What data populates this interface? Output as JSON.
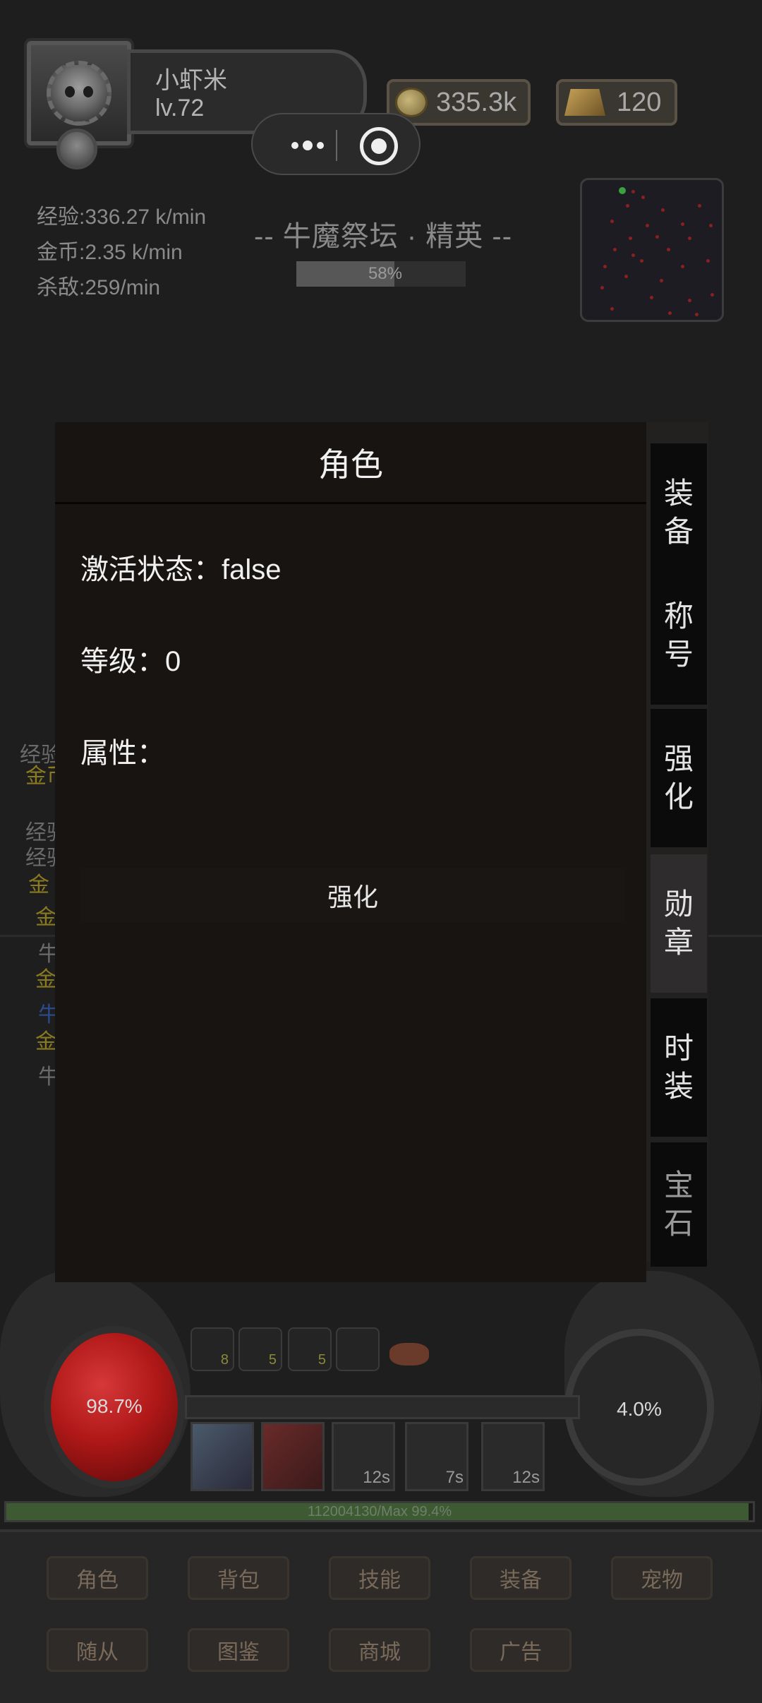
{
  "player": {
    "name": "小虾米",
    "level": "lv.72"
  },
  "currency": {
    "coins": "335.3k",
    "gold": "120"
  },
  "stats": {
    "exp_rate": "经验:336.27 k/min",
    "gold_rate": "金币:2.35 k/min",
    "kill_rate": "杀敌:259/min"
  },
  "zone": {
    "title": "-- 牛魔祭坛 · 精英 --",
    "progress_text": "58%",
    "progress": 0.58
  },
  "underlay_log": [
    {
      "text": "经验",
      "kind": "normal"
    },
    {
      "text": "金币",
      "kind": "gold"
    },
    {
      "text": "经验",
      "kind": "normal"
    },
    {
      "text": "经验",
      "kind": "normal"
    },
    {
      "text": "金",
      "kind": "gold"
    },
    {
      "text": "金",
      "kind": "gold"
    },
    {
      "text": "牛",
      "kind": "normal"
    },
    {
      "text": "金",
      "kind": "gold"
    },
    {
      "text": "牛",
      "kind": "blue"
    },
    {
      "text": "金",
      "kind": "gold"
    },
    {
      "text": "牛",
      "kind": "normal"
    }
  ],
  "modal": {
    "title": "角色",
    "props": [
      {
        "label": "激活状态：false"
      },
      {
        "label": "等级：0"
      },
      {
        "label": "属性："
      }
    ],
    "enhance_label": "强化"
  },
  "side_tabs": [
    {
      "label": "装备",
      "active": false
    },
    {
      "label": "称号",
      "active": false
    },
    {
      "label": "强化",
      "active": false
    },
    {
      "label": "勋章",
      "active": true
    },
    {
      "label": "时装",
      "active": false
    },
    {
      "label": "宝石",
      "active": false
    }
  ],
  "hud": {
    "hp_text": "98.7%",
    "mp_text": "4.0%",
    "buffs": [
      "8",
      "5",
      "5",
      ""
    ],
    "skills": [
      {
        "cd": ""
      },
      {
        "cd": ""
      },
      {
        "cd": "12s"
      },
      {
        "cd": "7s"
      },
      {
        "cd": "12s"
      }
    ],
    "exp_text": "112004130/Max    99.4%",
    "exp_fraction": 0.994
  },
  "menu": {
    "row1": [
      "角色",
      "背包",
      "技能",
      "装备",
      "宠物"
    ],
    "row2": [
      "随从",
      "图鉴",
      "商城",
      "广告"
    ]
  },
  "colors": {
    "modal_bg": "#181412",
    "hp": "#b01818",
    "exp": "#3d5a32"
  }
}
